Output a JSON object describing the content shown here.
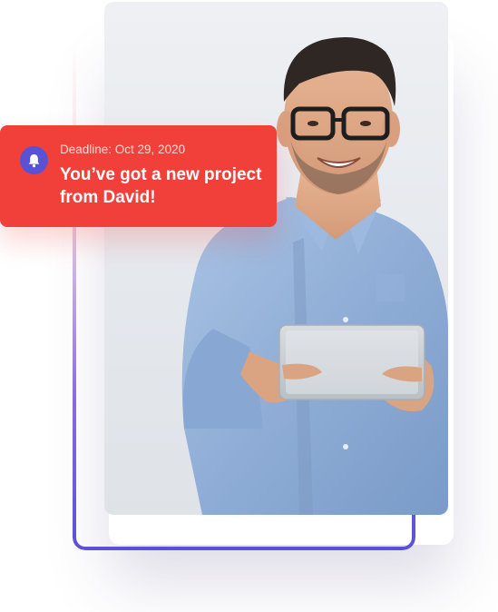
{
  "notification": {
    "deadline_text": "Deadline: Oct 29, 2020",
    "message_text": "You’ve got a new project from David!",
    "icon": "bell-icon",
    "background_color": "#f1403a",
    "icon_badge_color": "#5a52d5"
  },
  "photo": {
    "subject": "smiling man in glasses and blue denim shirt holding a tablet"
  },
  "frame": {
    "gradient_start_color": "#f4b7be",
    "gradient_end_color": "#5a50d8"
  }
}
